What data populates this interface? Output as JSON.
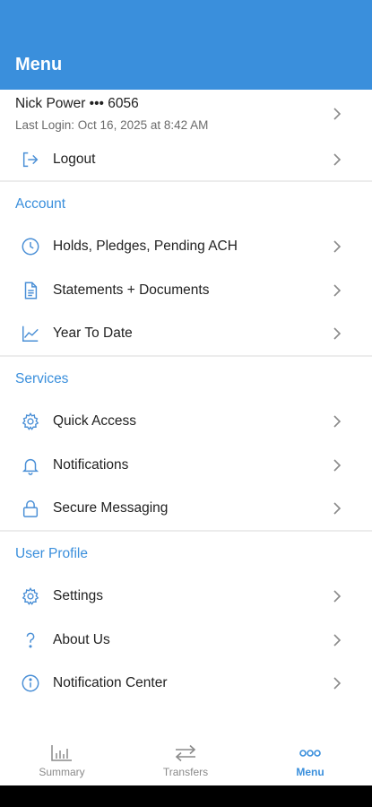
{
  "header": {
    "title": "Menu"
  },
  "user": {
    "name": "Nick Power ••• 6056",
    "last_login": "Last Login: Oct 16, 2025 at 8:42 AM"
  },
  "logout": {
    "label": "Logout",
    "icon": "logout-icon"
  },
  "sections": {
    "account": {
      "title": "Account",
      "items": [
        {
          "label": "Holds, Pledges, Pending ACH",
          "icon": "clock-icon"
        },
        {
          "label": "Statements + Documents",
          "icon": "document-icon"
        },
        {
          "label": "Year To Date",
          "icon": "line-chart-icon"
        }
      ]
    },
    "services": {
      "title": "Services",
      "items": [
        {
          "label": "Quick Access",
          "icon": "gear-icon"
        },
        {
          "label": "Notifications",
          "icon": "bell-icon"
        },
        {
          "label": "Secure Messaging",
          "icon": "lock-icon"
        }
      ]
    },
    "user_profile": {
      "title": "User Profile",
      "items": [
        {
          "label": "Settings",
          "icon": "gear-icon"
        },
        {
          "label": "About Us",
          "icon": "question-icon"
        },
        {
          "label": "Notification Center",
          "icon": "info-icon"
        }
      ]
    }
  },
  "bottom_nav": {
    "items": [
      {
        "label": "Summary",
        "icon": "bar-chart-icon",
        "active": false
      },
      {
        "label": "Transfers",
        "icon": "transfer-arrows-icon",
        "active": false
      },
      {
        "label": "Menu",
        "icon": "dots-icon",
        "active": true
      }
    ]
  },
  "colors": {
    "accent": "#3a8fdc",
    "icon": "#4a8fd6",
    "text": "#222222",
    "muted": "#6b6b6b",
    "nav_inactive": "#8a8a8a"
  }
}
